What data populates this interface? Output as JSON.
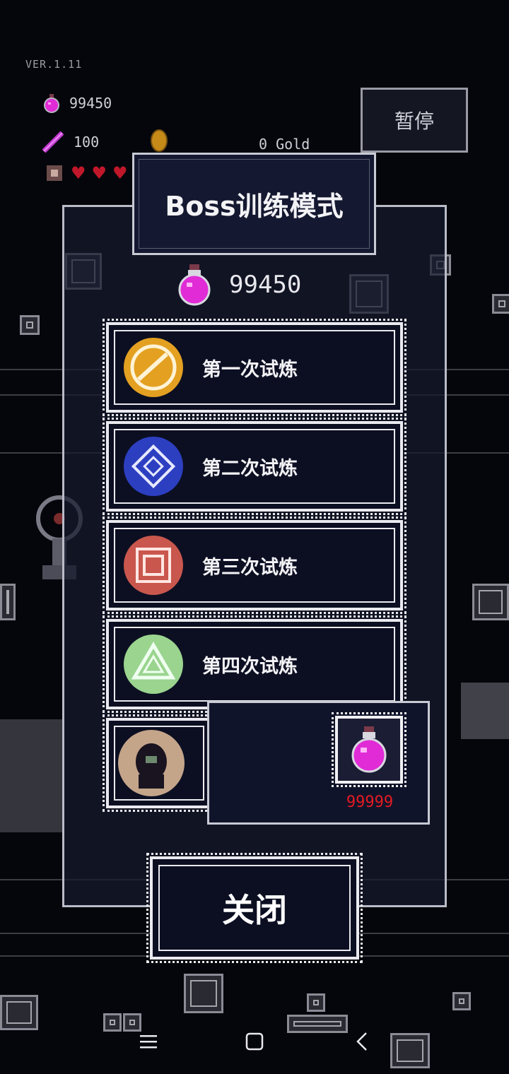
{
  "version": "VER.1.11",
  "hud": {
    "orbs": "99450",
    "weapon": "100",
    "gold": "0 Gold",
    "hearts": 3
  },
  "pause_label": "暂停",
  "dialog": {
    "title": "Boss训练模式",
    "orb_balance": "99450",
    "trials": [
      {
        "label": "第一次试炼",
        "color": "#e3a021"
      },
      {
        "label": "第二次试炼",
        "color": "#2d3fc1"
      },
      {
        "label": "第三次试炼",
        "color": "#c9574d"
      },
      {
        "label": "第四次试炼",
        "color": "#9ad48f"
      }
    ],
    "locked_trial_icon": "hooded-figure-icon",
    "cost_popup": {
      "price": "99999",
      "price_color": "#e31b23"
    },
    "close_label": "关闭"
  },
  "colors": {
    "potion": "#e02bd6",
    "panel_border": "#c8cad4",
    "heart": "#c0182a"
  },
  "navbar": {
    "menu_icon": "menu-icon",
    "home_icon": "home-icon",
    "back_icon": "back-icon"
  }
}
